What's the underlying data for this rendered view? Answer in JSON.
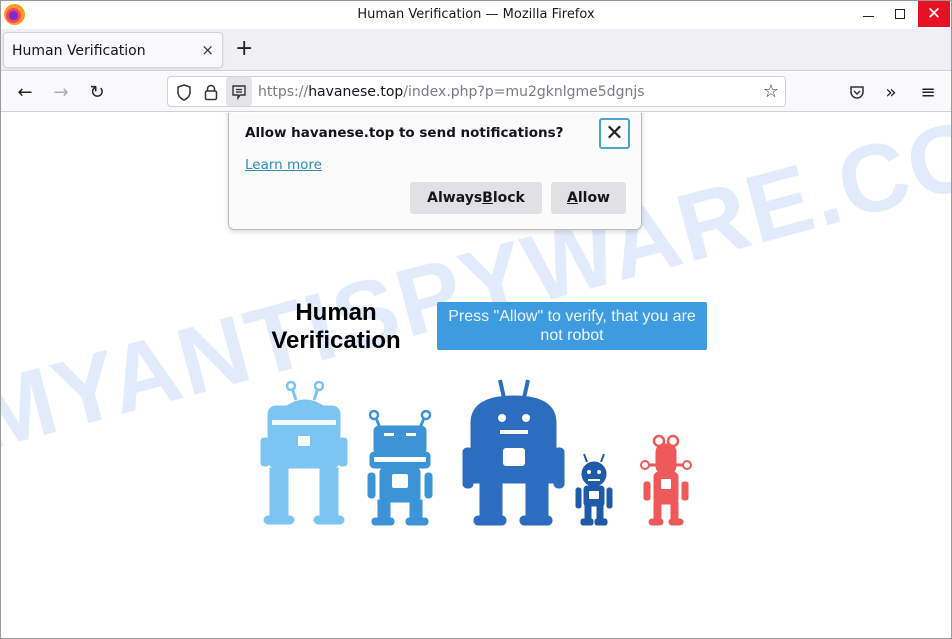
{
  "window": {
    "title": "Human Verification — Mozilla Firefox",
    "controls": {
      "minimize": "minimize",
      "maximize": "maximize",
      "close": "✕"
    }
  },
  "tabs": [
    {
      "title": "Human Verification",
      "active": true,
      "close_glyph": "×"
    }
  ],
  "new_tab_glyph": "+",
  "navbar": {
    "back_glyph": "←",
    "forward_glyph": "→",
    "reload_glyph": "↻",
    "url_scheme": "https://",
    "url_host": "havanese.top",
    "url_path": "/index.php?p=mu2gknlgme5dgnjs",
    "star_glyph": "☆",
    "overflow_glyph": "»",
    "menu_glyph": "≡"
  },
  "notification_popup": {
    "message": "Allow havanese.top to send notifications?",
    "learn_more": "Learn more",
    "close_glyph": "✕",
    "block_button": {
      "pre": "Always ",
      "accel": "B",
      "post": "lock"
    },
    "allow_button": {
      "pre": "",
      "accel": "A",
      "post": "llow"
    }
  },
  "page": {
    "heading": "Human Verification",
    "instruction": "Press \"Allow\" to verify, that you are not robot",
    "watermark": "MYANTISPYWARE.COM",
    "robot_colors": [
      "#7cc4f2",
      "#3c94d6",
      "#2c6dbf",
      "#1f5aa8",
      "#ee5a5a"
    ]
  }
}
